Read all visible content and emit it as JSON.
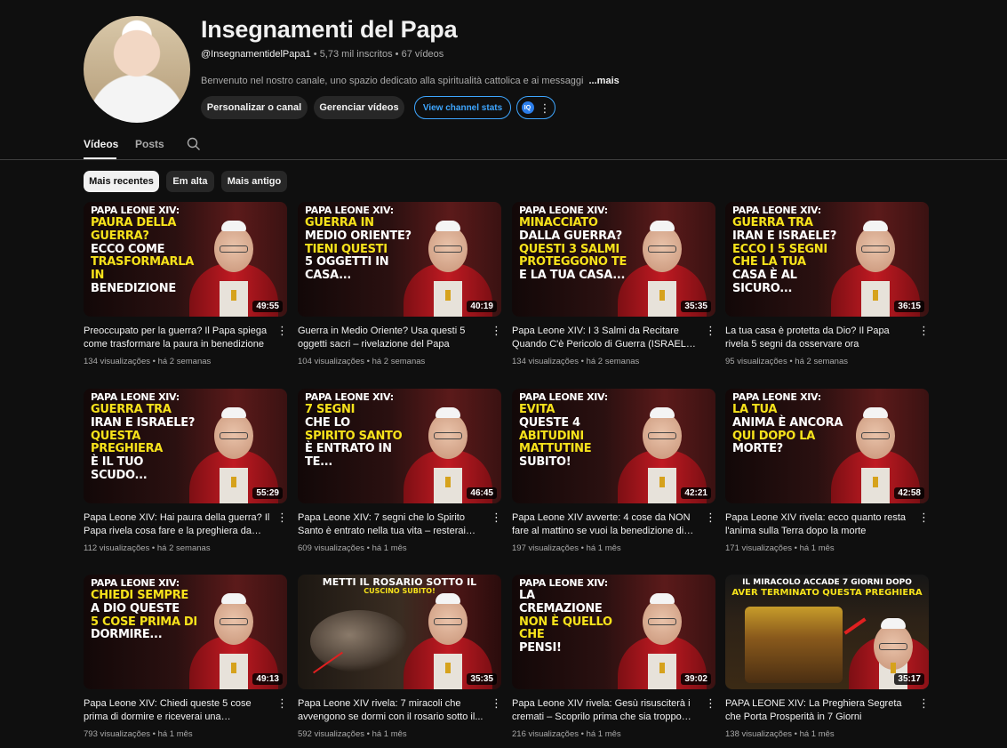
{
  "channel": {
    "title": "Insegnamenti del Papa",
    "handle": "@InsegnamentidelPapa1",
    "subscribers": "5,73 mil inscritos",
    "videos_count": "67 vídeos",
    "description": "Benvenuto nel nostro canale, uno spazio dedicato alla spiritualità cattolica e ai messaggi",
    "more_label": "...mais",
    "avatar_icon": "channel-avatar"
  },
  "buttons": {
    "customize": "Personalizar o canal",
    "manage_videos": "Gerenciar vídeos",
    "view_stats": "View channel stats",
    "ext_badge": "IQ",
    "ext_dots": "⋮"
  },
  "tabs": {
    "videos": "Vídeos",
    "posts": "Posts"
  },
  "chips": {
    "recent": "Mais recentes",
    "popular": "Em alta",
    "oldest": "Mais antigo"
  },
  "videos": [
    {
      "thumb_lines": [
        "PAPA LEONE XIV:",
        "PAURA DELLA GUERRA?",
        "ECCO COME",
        "TRASFORMARLA IN",
        "BENEDIZIONE"
      ],
      "duration": "49:55",
      "title": "Preoccupato per la guerra? Il Papa spiega come trasformare la paura in benedizione",
      "views": "134 visualizações",
      "age": "há 2 semanas"
    },
    {
      "thumb_lines": [
        "PAPA LEONE XIV:",
        "GUERRA IN",
        "MEDIO ORIENTE?",
        "TIENI QUESTI",
        "5 OGGETTI IN CASA..."
      ],
      "duration": "40:19",
      "title": "Guerra in Medio Oriente? Usa questi 5 oggetti sacri – rivelazione del Papa",
      "views": "104 visualizações",
      "age": "há 2 semanas"
    },
    {
      "thumb_lines": [
        "PAPA LEONE XIV:",
        "MINACCIATO",
        "DALLA GUERRA?",
        "QUESTI 3 SALMI PROTEGGONO TE",
        "E LA TUA CASA..."
      ],
      "duration": "35:35",
      "title": "Papa Leone XIV: I 3 Salmi da Recitare Quando C'è Pericolo di Guerra (ISRAELE vs...",
      "views": "134 visualizações",
      "age": "há 2 semanas"
    },
    {
      "thumb_lines": [
        "PAPA LEONE XIV:",
        "GUERRA TRA",
        "IRAN E ISRAELE?",
        "ECCO I 5 SEGNI CHE LA TUA",
        "CASA È AL SICURO..."
      ],
      "duration": "36:15",
      "title": "La tua casa è protetta da Dio? Il Papa rivela 5 segni da osservare ora",
      "views": "95 visualizações",
      "age": "há 2 semanas"
    },
    {
      "thumb_lines": [
        "PAPA LEONE XIV:",
        "GUERRA TRA",
        "IRAN E ISRAELE?",
        "QUESTA PREGHIERA",
        "È IL TUO SCUDO..."
      ],
      "duration": "55:29",
      "title": "Papa Leone XIV: Hai paura della guerra? Il Papa rivela cosa fare e la preghiera da non...",
      "views": "112 visualizações",
      "age": "há 2 semanas"
    },
    {
      "thumb_lines": [
        "PAPA LEONE XIV:",
        "7 SEGNI",
        "CHE LO",
        "SPIRITO SANTO",
        "È ENTRATO IN TE..."
      ],
      "duration": "46:45",
      "title": "Papa Leone XIV: 7 segni che lo Spirito Santo è entrato nella tua vita – resterai stupito",
      "views": "609 visualizações",
      "age": "há 1 mês"
    },
    {
      "thumb_lines": [
        "PAPA LEONE XIV:",
        "EVITA",
        "QUESTE 4",
        "ABITUDINI MATTUTINE",
        "SUBITO!"
      ],
      "duration": "42:21",
      "title": "Papa Leone XIV avverte: 4 cose da NON fare al mattino se vuoi la benedizione di Dio",
      "views": "197 visualizações",
      "age": "há 1 mês"
    },
    {
      "thumb_lines": [
        "PAPA LEONE XIV:",
        "LA TUA",
        "ANIMA È ANCORA",
        "QUI DOPO LA",
        "MORTE?"
      ],
      "duration": "42:58",
      "title": "Papa Leone XIV rivela: ecco quanto resta l'anima sulla Terra dopo la morte",
      "views": "171 visualizações",
      "age": "há 1 mês"
    },
    {
      "thumb_lines": [
        "PAPA LEONE XIV:",
        "CHIEDI SEMPRE",
        "A DIO QUESTE",
        "5 COSE PRIMA DI",
        "DORMIRE..."
      ],
      "duration": "49:13",
      "title": "Papa Leone XIV: Chiedi queste 5 cose prima di dormire e riceverai una benedizione...",
      "views": "793 visualizações",
      "age": "há 1 mês"
    },
    {
      "thumb_lines": [
        "METTI IL ROSARIO SOTTO IL",
        "CUSCINO SUBITO!"
      ],
      "duration": "35:35",
      "title": "Papa Leone XIV rivela: 7 miracoli che avvengono se dormi con il rosario sotto il...",
      "views": "592 visualizações",
      "age": "há 1 mês"
    },
    {
      "thumb_lines": [
        "PAPA LEONE XIV:",
        "LA",
        "CREMAZIONE",
        "NON È QUELLO CHE",
        "PENSI!"
      ],
      "duration": "39:02",
      "title": "Papa Leone XIV rivela: Gesù risusciterà i cremati – Scoprilo prima che sia troppo tardi",
      "views": "216 visualizações",
      "age": "há 1 mês"
    },
    {
      "thumb_lines": [
        "IL MIRACOLO ACCADE 7 GIORNI DOPO",
        "AVER TERMINATO QUESTA PREGHIERA"
      ],
      "duration": "35:17",
      "title": "PAPA LEONE XIV: La Preghiera Segreta che Porta Prosperità in 7 Giorni",
      "views": "138 visualizações",
      "age": "há 1 mês"
    }
  ],
  "icons": {
    "search": "search-icon",
    "kebab": "more-vert-icon"
  }
}
